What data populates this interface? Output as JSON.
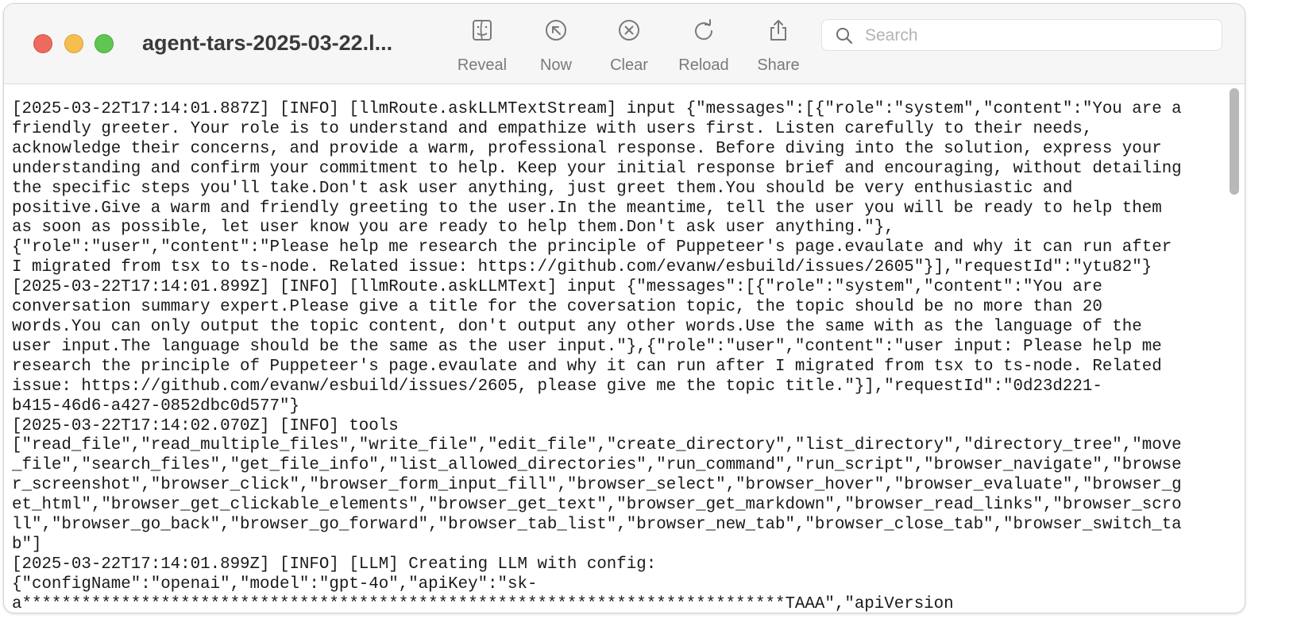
{
  "window": {
    "title": "agent-tars-2025-03-22.l..."
  },
  "toolbar": {
    "buttons": [
      {
        "label": "Reveal",
        "icon": "finder-icon"
      },
      {
        "label": "Now",
        "icon": "arrow-up-left-circle-icon"
      },
      {
        "label": "Clear",
        "icon": "x-circle-icon"
      },
      {
        "label": "Reload",
        "icon": "reload-icon"
      },
      {
        "label": "Share",
        "icon": "share-icon"
      }
    ]
  },
  "search": {
    "placeholder": "Search",
    "value": ""
  },
  "log": {
    "lines": [
      "[2025-03-22T17:14:01.887Z] [INFO] [llmRoute.askLLMTextStream] input {\"messages\":[{\"role\":\"system\",\"content\":\"You are a",
      "friendly greeter. Your role is to understand and empathize with users first. Listen carefully to their needs,",
      "acknowledge their concerns, and provide a warm, professional response. Before diving into the solution, express your",
      "understanding and confirm your commitment to help. Keep your initial response brief and encouraging, without detailing",
      "the specific steps you'll take.Don't ask user anything, just greet them.You should be very enthusiastic and",
      "positive.Give a warm and friendly greeting to the user.In the meantime, tell the user you will be ready to help them",
      "as soon as possible, let user know you are ready to help them.Don't ask user anything.\"},",
      "{\"role\":\"user\",\"content\":\"Please help me research the principle of Puppeteer's page.evaulate and why it can run after",
      "I migrated from tsx to ts-node. Related issue: https://github.com/evanw/esbuild/issues/2605\"}],\"requestId\":\"ytu82\"}",
      "[2025-03-22T17:14:01.899Z] [INFO] [llmRoute.askLLMText] input {\"messages\":[{\"role\":\"system\",\"content\":\"You are",
      "conversation summary expert.Please give a title for the coversation topic, the topic should be no more than 20",
      "words.You can only output the topic content, don't output any other words.Use the same with as the language of the",
      "user input.The language should be the same as the user input.\"},{\"role\":\"user\",\"content\":\"user input: Please help me",
      "research the principle of Puppeteer's page.evaulate and why it can run after I migrated from tsx to ts-node. Related",
      "issue: https://github.com/evanw/esbuild/issues/2605, please give me the topic title.\"}],\"requestId\":\"0d23d221-",
      "b415-46d6-a427-0852dbc0d577\"}",
      "[2025-03-22T17:14:02.070Z] [INFO] tools",
      "[\"read_file\",\"read_multiple_files\",\"write_file\",\"edit_file\",\"create_directory\",\"list_directory\",\"directory_tree\",\"move",
      "_file\",\"search_files\",\"get_file_info\",\"list_allowed_directories\",\"run_command\",\"run_script\",\"browser_navigate\",\"browse",
      "r_screenshot\",\"browser_click\",\"browser_form_input_fill\",\"browser_select\",\"browser_hover\",\"browser_evaluate\",\"browser_g",
      "et_html\",\"browser_get_clickable_elements\",\"browser_get_text\",\"browser_get_markdown\",\"browser_read_links\",\"browser_scro",
      "ll\",\"browser_go_back\",\"browser_go_forward\",\"browser_tab_list\",\"browser_new_tab\",\"browser_close_tab\",\"browser_switch_ta",
      "b\"]",
      "[2025-03-22T17:14:01.899Z] [INFO] [LLM] Creating LLM with config:",
      "{\"configName\":\"openai\",\"model\":\"gpt-4o\",\"apiKey\":\"sk-",
      "a*****************************************************************************TAAA\",\"apiVersion"
    ]
  }
}
